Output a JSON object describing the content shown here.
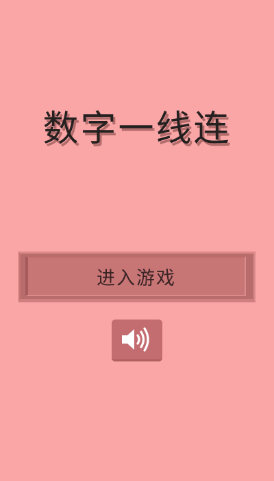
{
  "screen": {
    "background_color": "#fba6a6"
  },
  "title": {
    "text": "数字一线连",
    "color": "#252020"
  },
  "start_button": {
    "label": "进入游戏",
    "color": "#c87576"
  },
  "sound_button": {
    "icon": "speaker-volume-icon",
    "state": "on",
    "color": "#c46d70"
  }
}
